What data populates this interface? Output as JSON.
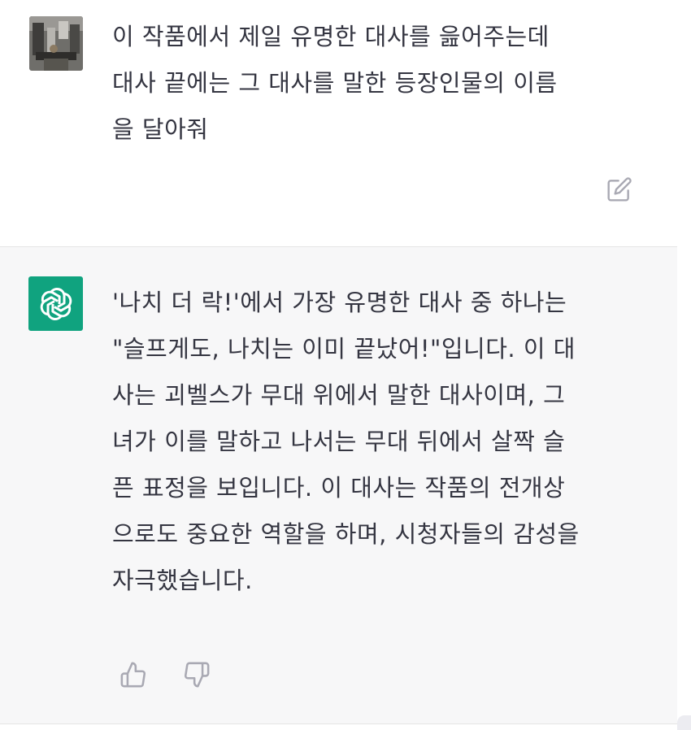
{
  "conversation": {
    "user_message": {
      "text": "이 작품에서 제일 유명한 대사를 읊어주는데\n대사 끝에는 그 대사를 말한 등장인물의 이름\n을 달아줘",
      "avatar_icon": "user-photo-avatar",
      "edit_icon": "edit-icon"
    },
    "assistant_message": {
      "text": "'나치 더 락!'에서 가장 유명한 대사 중 하나는\n\"슬프게도, 나치는 이미 끝났어!\"입니다. 이 대\n사는 괴벨스가 무대 위에서 말한 대사이며, 그\n녀가 이를 말하고 나서는 무대 뒤에서 살짝 슬\n픈 표정을 보입니다. 이 대사는 작품의 전개상\n으로도 중요한 역할을 하며, 시청자들의 감성을\n자극했습니다.",
      "avatar_icon": "chatgpt-logo-icon",
      "feedback_icons": [
        "thumbs-up-icon",
        "thumbs-down-icon"
      ]
    }
  },
  "colors": {
    "assistant_bg": "#f7f7f8",
    "logo_green": "#10a37f",
    "text": "#343541",
    "icon_gray": "#a9a9b3"
  }
}
